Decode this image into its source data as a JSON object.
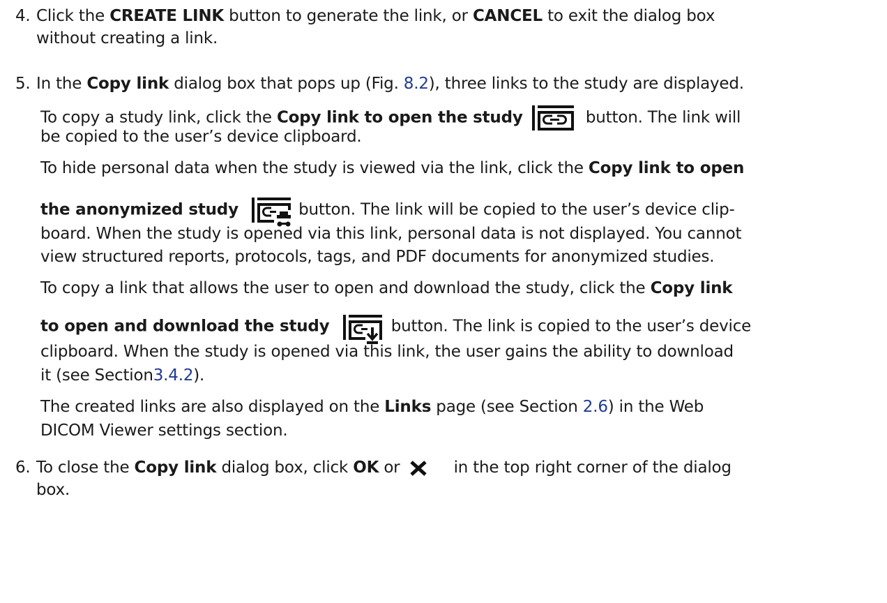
{
  "steps": [
    {
      "number": "4.",
      "lines": [
        {
          "pre": "Click the ",
          "b1": "CREATE LINK",
          "mid": " button to generate the link, or ",
          "b2": "CANCEL",
          "post": " to exit the dialog box"
        },
        {
          "text": "without creating a link."
        }
      ]
    },
    {
      "number": "5.",
      "intro": {
        "pre": "In the ",
        "bold": "Copy link",
        "mid": " dialog box that pops up (Fig. ",
        "ref": "8.2",
        "post": "), three links to the study are displayed."
      },
      "para1": {
        "pre": "To copy a study link, click the ",
        "bold": "Copy link to open the study",
        "post": " button.  The link will",
        "line2": "be copied to the user’s device clipboard."
      },
      "para2": {
        "l1_pre": "To hide personal data when the study is viewed via the link, click the ",
        "l1_bold": "Copy link to open",
        "l2_bold": "the anonymized study",
        "l2_post": " button.  The link will be copied to the user’s device clip-",
        "l3": "board.  When the study is opened via this link, personal data is not displayed.  You cannot",
        "l4": "view structured reports, protocols, tags, and PDF documents for anonymized studies."
      },
      "para3": {
        "l1_pre": "To copy a link that allows the user to open and download the study, click the ",
        "l1_bold": "Copy link",
        "l2_bold": "to open and download the study",
        "l2_post": " button.  The link is copied to the user’s device",
        "l3": "clipboard.  When the study is opened via this link, the user gains the ability to download",
        "l4_pre": "it (see Section",
        "l4_ref": "3.4.2",
        "l4_post": ")."
      },
      "para4": {
        "l1_pre": "The created links are also displayed on the ",
        "l1_bold": "Links",
        "l1_mid": " page (see Section ",
        "l1_ref": "2.6",
        "l1_post": ") in the Web",
        "l2": "DICOM Viewer settings section."
      }
    },
    {
      "number": "6.",
      "pre": "To close the ",
      "bold": "Copy link",
      "mid": " dialog box, click ",
      "bold2": "OK",
      "mid2": " or ",
      "post": "in the top right corner of the dialog",
      "line2": "box."
    }
  ],
  "icons": {
    "open_study": "copy-link-icon",
    "anonymized": "copy-anonymized-link-icon",
    "download": "copy-download-link-icon",
    "close": "close-icon"
  },
  "colors": {
    "text": "#1a1a1a",
    "reference": "#1f3a93"
  }
}
